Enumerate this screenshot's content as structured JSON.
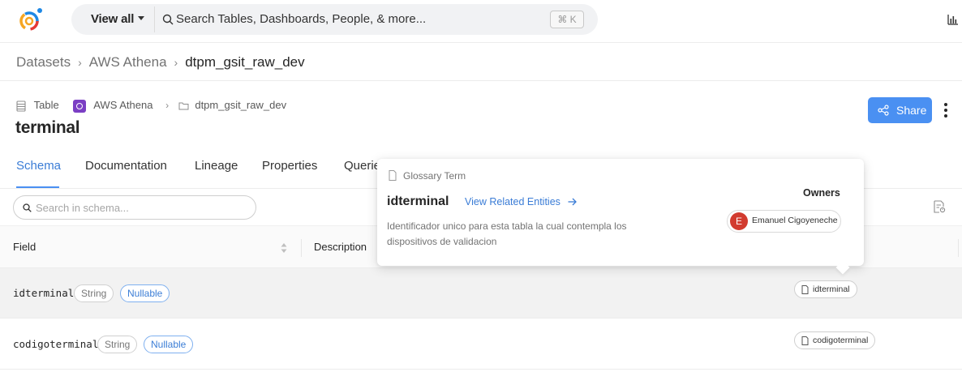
{
  "topbar": {
    "view_all_label": "View all",
    "search_placeholder": "Search Tables, Dashboards, People, & more...",
    "shortcut": "⌘ K"
  },
  "breadcrumb": {
    "items": [
      "Datasets",
      "AWS Athena"
    ],
    "current": "dtpm_gsit_raw_dev",
    "separator": "›"
  },
  "entity": {
    "type": "Table",
    "platform": "AWS Athena",
    "container": "dtpm_gsit_raw_dev",
    "name": "terminal",
    "share_label": "Share"
  },
  "tabs": [
    "Schema",
    "Documentation",
    "Lineage",
    "Properties",
    "Queries"
  ],
  "schema": {
    "search_placeholder": "Search in schema...",
    "columns": {
      "field": "Field",
      "description": "Description"
    },
    "rows": [
      {
        "name": "idterminal",
        "type": "String",
        "nullable": "Nullable",
        "term": "idterminal"
      },
      {
        "name": "codigoterminal",
        "type": "String",
        "nullable": "Nullable",
        "term": "codigoterminal"
      }
    ]
  },
  "popover": {
    "kind": "Glossary Term",
    "title": "idterminal",
    "link": "View Related Entities",
    "description": "Identificador unico para esta tabla la cual contempla los dispositivos de validacion",
    "owners_label": "Owners",
    "owner": {
      "initial": "E",
      "name": "Emanuel Cigoyeneche"
    }
  },
  "colors": {
    "accent": "#4a90f2",
    "link": "#3a7cd6",
    "owner_avatar": "#d23b2f",
    "platform": "#7b3fc4"
  }
}
